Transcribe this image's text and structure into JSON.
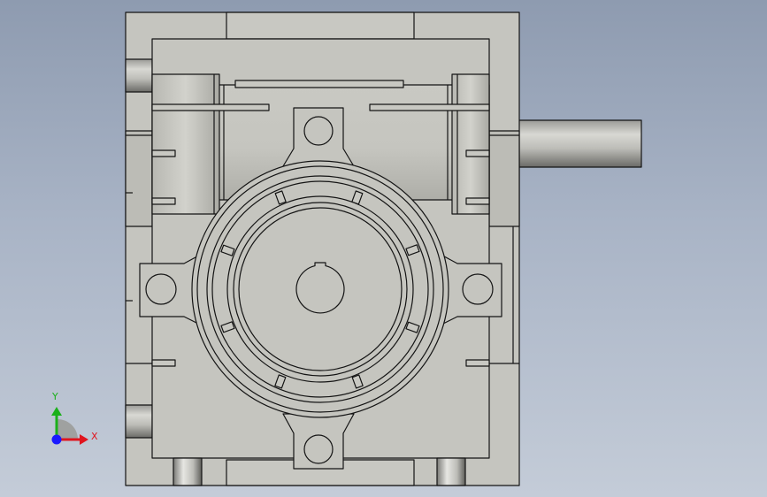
{
  "axes": {
    "x_label": "X",
    "y_label": "Y",
    "x_color": "#e0141e",
    "y_color": "#1bb01b",
    "origin_color": "#1a1aff"
  },
  "colors": {
    "background_top": "#8e9bb0",
    "background_bottom": "#c4ccd8",
    "housing_fill": "#c5c5bf",
    "edge": "#141414",
    "shaft_light": "#d4d4cf",
    "shaft_dark": "#6a6a66"
  }
}
